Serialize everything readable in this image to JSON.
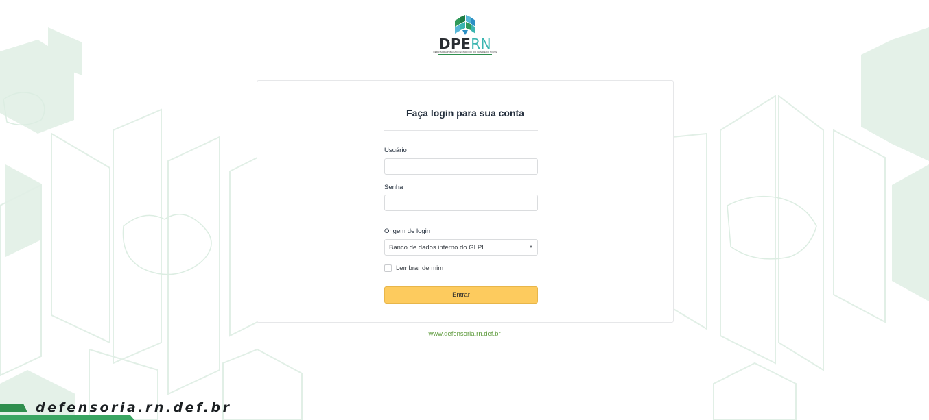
{
  "logo": {
    "name_primary": "DPE",
    "name_secondary": "RN",
    "subtitle": "DEFENSORIA PÚBLICA DO ESTADO DO RIO GRANDE DO NORTE"
  },
  "login": {
    "title": "Faça login para sua conta",
    "username_label": "Usuário",
    "username_value": "",
    "password_label": "Senha",
    "password_value": "",
    "source_label": "Origem de login",
    "source_selected": "Banco de dados interno do GLPI",
    "remember_label": "Lembrar de mim",
    "submit_label": "Entrar"
  },
  "footer": {
    "link_text": "www.defensoria.rn.def.br"
  },
  "banner": {
    "text": "defensoria.rn.def.br"
  },
  "colors": {
    "accent_button": "#fdcb5e",
    "link": "#5c9a3a",
    "background_pattern": "#e4f1e8",
    "banner_green": "#2f8f4e"
  }
}
